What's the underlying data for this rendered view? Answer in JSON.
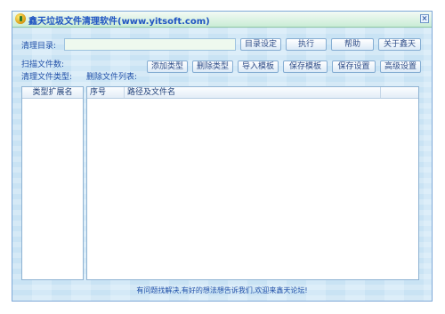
{
  "window": {
    "title": "鑫天垃圾文件清理软件(www.yitsoft.com)"
  },
  "form": {
    "clean_dir_label": "清理目录:",
    "clean_dir_value": "",
    "scan_count_label": "扫描文件数:",
    "clean_type_label": "清理文件类型:",
    "delete_list_label": "删除文件列表:"
  },
  "buttons": {
    "dir_setting": "目录设定",
    "execute": "执行",
    "help": "帮助",
    "about": "关于鑫天",
    "add_type": "添加类型",
    "delete_type": "删除类型",
    "import_template": "导入模板",
    "save_template": "保存模板",
    "save_settings": "保存设置",
    "advanced_settings": "高级设置"
  },
  "type_list": {
    "header": "类型扩展名"
  },
  "file_list": {
    "columns": [
      "序号",
      "路径及文件名"
    ]
  },
  "footer": {
    "text": "有问题找解决,有好的想法想告诉我们,欢迎来鑫天论坛!"
  }
}
